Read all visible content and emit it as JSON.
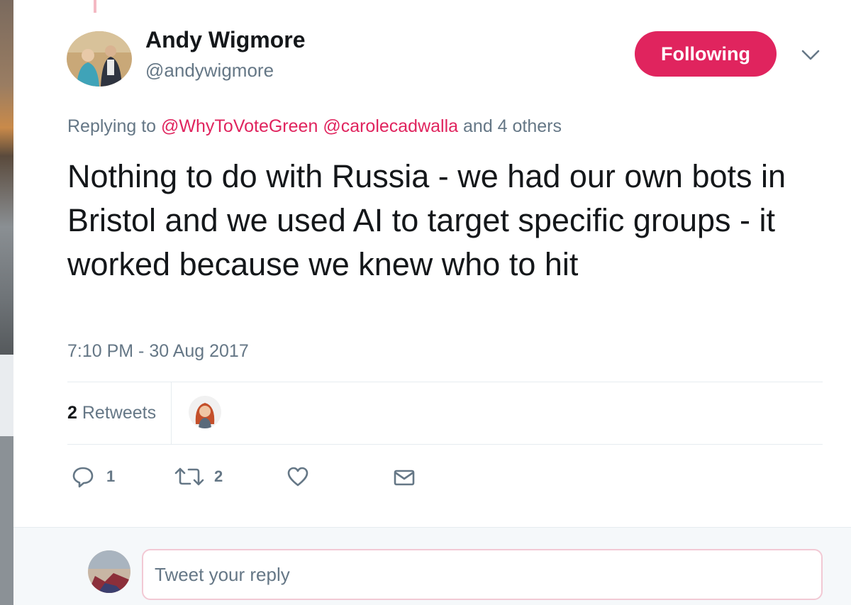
{
  "author": {
    "display_name": "Andy Wigmore",
    "handle": "@andywigmore"
  },
  "follow_button": {
    "label": "Following"
  },
  "replying_to": {
    "prefix": "Replying to",
    "mentions": [
      "@WhyToVoteGreen",
      "@carolecadwalla"
    ],
    "suffix": "and 4 others"
  },
  "tweet": {
    "text": "Nothing to do with Russia - we had our own bots in Bristol and we used AI to target specific groups - it worked because we knew who to hit",
    "timestamp": "7:10 PM - 30 Aug 2017"
  },
  "stats": {
    "retweets_count": "2",
    "retweets_label": "Retweets"
  },
  "actions": {
    "reply_count": "1",
    "retweet_count": "2"
  },
  "reply_box": {
    "placeholder": "Tweet your reply"
  },
  "colors": {
    "accent": "#e0245e",
    "text_primary": "#14171a",
    "text_secondary": "#657786",
    "divider": "#e6ecf0"
  },
  "icons": [
    "chevron-down-icon",
    "reply-icon",
    "retweet-icon",
    "like-icon",
    "message-icon"
  ]
}
